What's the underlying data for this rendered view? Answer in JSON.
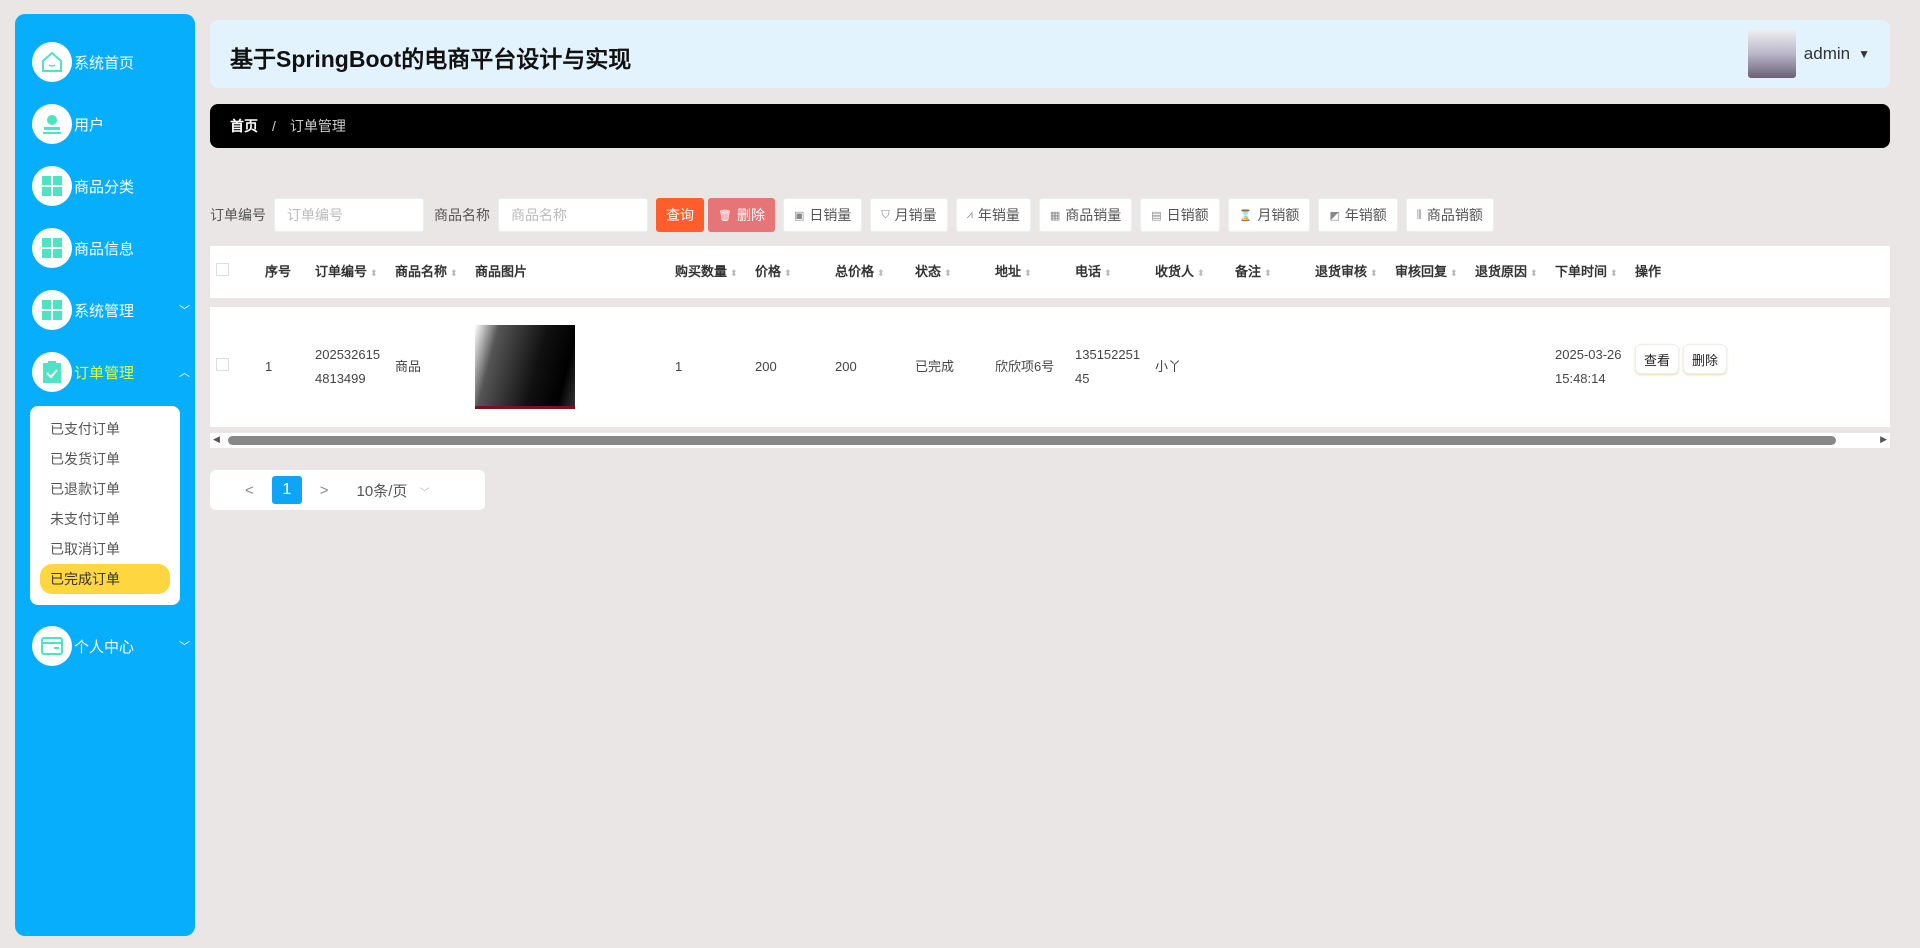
{
  "sidebar": {
    "items": [
      {
        "label": "系统首页",
        "icon": "home-icon"
      },
      {
        "label": "用户",
        "icon": "user-stamp-icon"
      },
      {
        "label": "商品分类",
        "icon": "grid-icon"
      },
      {
        "label": "商品信息",
        "icon": "grid-icon"
      },
      {
        "label": "系统管理",
        "icon": "grid-icon"
      },
      {
        "label": "订单管理",
        "icon": "clipboard-check-icon"
      },
      {
        "label": "个人中心",
        "icon": "card-icon"
      }
    ],
    "order_sub": [
      "已支付订单",
      "已发货订单",
      "已退款订单",
      "未支付订单",
      "已取消订单",
      "已完成订单"
    ],
    "selected_sub": "已完成订单"
  },
  "header": {
    "title": "基于SpringBoot的电商平台设计与实现",
    "user": "admin"
  },
  "breadcrumb": {
    "home": "首页",
    "sep": "/",
    "current": "订单管理"
  },
  "filter": {
    "order_no_label": "订单编号",
    "order_no_placeholder": "订单编号",
    "product_label": "商品名称",
    "product_placeholder": "商品名称",
    "search": "查询",
    "delete": "删除",
    "stats": [
      "日销量",
      "月销量",
      "年销量",
      "商品销量",
      "日销额",
      "月销额",
      "年销额",
      "商品销额"
    ]
  },
  "table": {
    "headers": [
      "序号",
      "订单编号",
      "商品名称",
      "商品图片",
      "购买数量",
      "价格",
      "总价格",
      "状态",
      "地址",
      "电话",
      "收货人",
      "备注",
      "退货审核",
      "审核回复",
      "退货原因",
      "下单时间",
      "操作"
    ],
    "rows": [
      {
        "index": "1",
        "order_no": "2025326154813499",
        "product": "商品",
        "qty": "1",
        "price": "200",
        "total": "200",
        "status": "已完成",
        "address": "欣欣项6号",
        "phone": "13515225145",
        "receiver": "小丫",
        "remark": "",
        "return_review": "",
        "review_reply": "",
        "return_reason": "",
        "time_date": "2025-03-26",
        "time_clock": "15:48:14",
        "view": "查看",
        "delete": "删除"
      }
    ]
  },
  "pagination": {
    "prev": "<",
    "page": "1",
    "next": ">",
    "size": "10条/页"
  },
  "colors": {
    "sidebar": "#06aefc",
    "active": "#dcff3a",
    "selected": "#fdd640",
    "search": "#fe5e2c",
    "delete": "#e67578"
  }
}
